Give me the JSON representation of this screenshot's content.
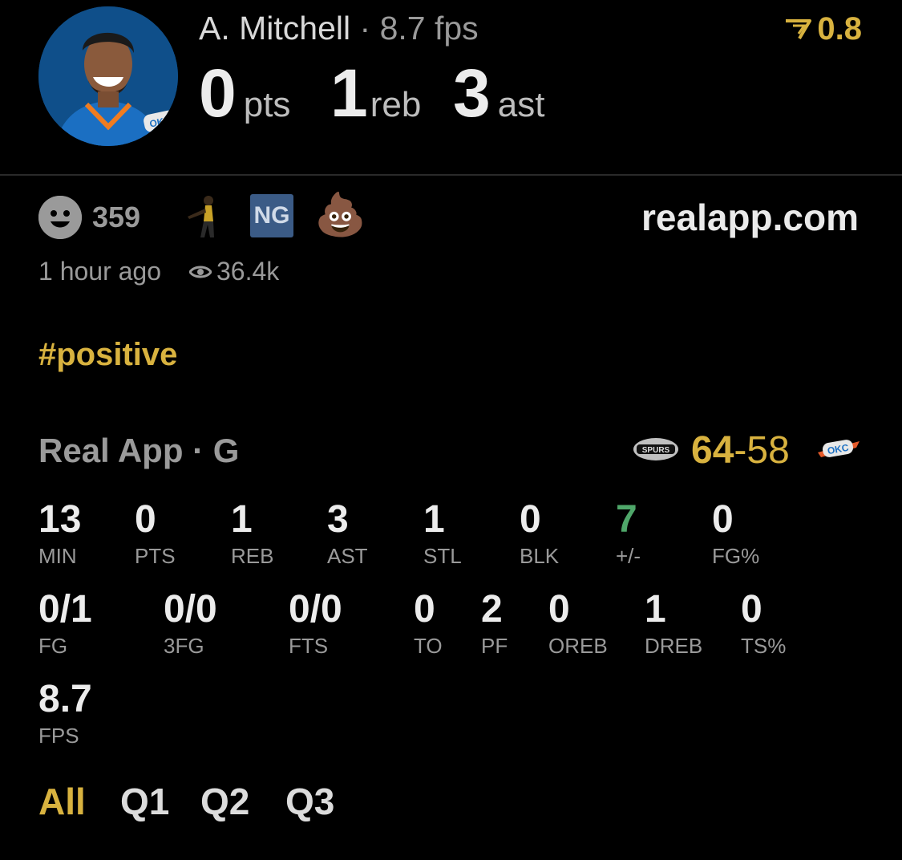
{
  "header": {
    "player_name": "A. Mitchell",
    "separator": "·",
    "fps_text": "8.7 fps",
    "pts_value": "0",
    "pts_unit": "pts",
    "reb_value": "1",
    "reb_unit": "reb",
    "ast_value": "3",
    "ast_unit": "ast",
    "rating": "0.8"
  },
  "meta": {
    "reaction_count": "359",
    "badge_ng": "NG",
    "poop_emoji": "💩",
    "site": "realapp.com",
    "time_ago": "1 hour ago",
    "views": "36.4k"
  },
  "hashtag": "#positive",
  "game": {
    "title": "Real App · G",
    "home_score": "64",
    "dash": "-",
    "away_score": "58"
  },
  "stats_row1": [
    {
      "value": "13",
      "label": "MIN"
    },
    {
      "value": "0",
      "label": "PTS"
    },
    {
      "value": "1",
      "label": "REB"
    },
    {
      "value": "3",
      "label": "AST"
    },
    {
      "value": "1",
      "label": "STL"
    },
    {
      "value": "0",
      "label": "BLK"
    },
    {
      "value": "7",
      "label": "+/-"
    },
    {
      "value": "0",
      "label": "FG%"
    }
  ],
  "stats_row2": [
    {
      "value": "0/1",
      "label": "FG"
    },
    {
      "value": "0/0",
      "label": "3FG"
    },
    {
      "value": "0/0",
      "label": "FTS"
    },
    {
      "value": "0",
      "label": "TO"
    },
    {
      "value": "2",
      "label": "PF"
    },
    {
      "value": "0",
      "label": "OREB"
    },
    {
      "value": "1",
      "label": "DREB"
    },
    {
      "value": "0",
      "label": "TS%"
    }
  ],
  "stats_row3": [
    {
      "value": "8.7",
      "label": "FPS"
    }
  ],
  "tabs": [
    "All",
    "Q1",
    "Q2",
    "Q3"
  ],
  "colors": {
    "gold": "#d8b23f",
    "green": "#4fa76a",
    "grey": "#8e8e93"
  }
}
